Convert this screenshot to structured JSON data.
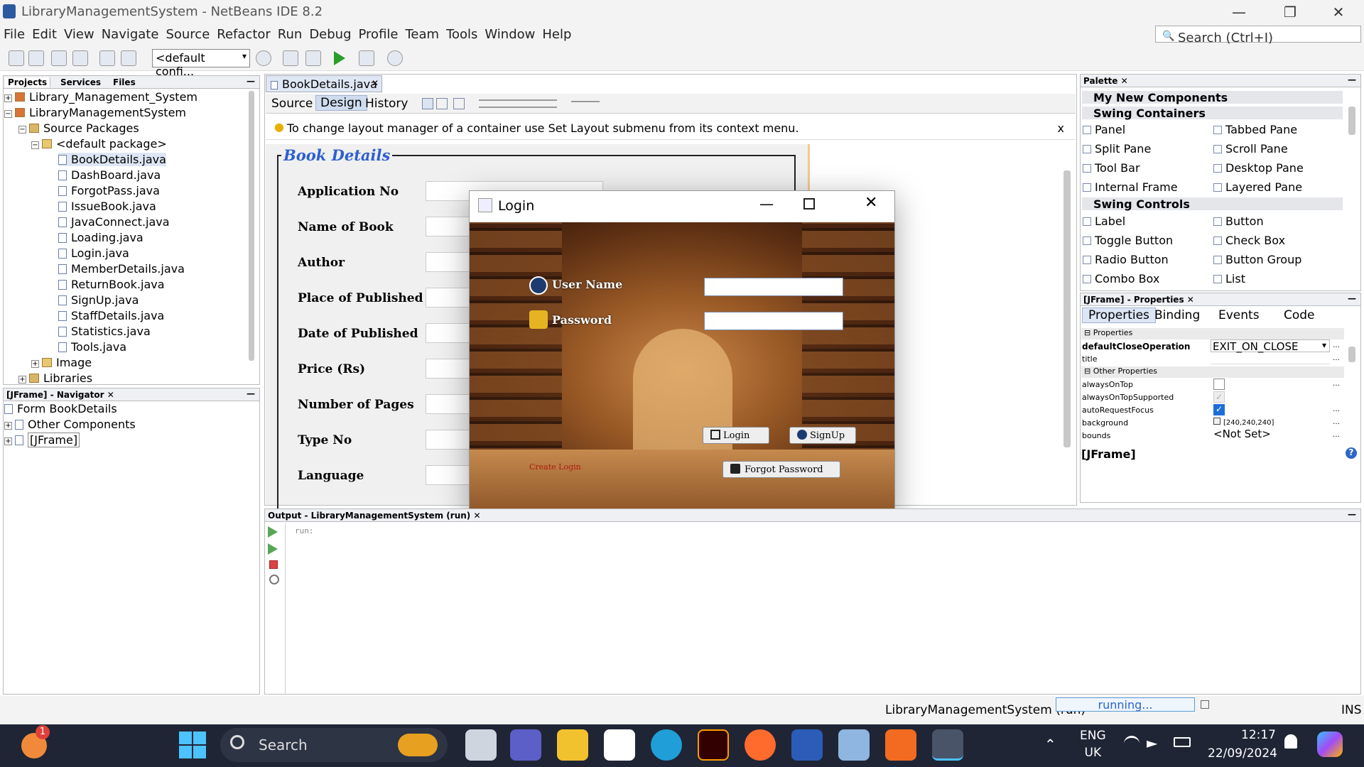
{
  "window": {
    "title": "LibraryManagementSystem - NetBeans IDE 8.2"
  },
  "menu": [
    "File",
    "Edit",
    "View",
    "Navigate",
    "Source",
    "Refactor",
    "Run",
    "Debug",
    "Profile",
    "Team",
    "Tools",
    "Window",
    "Help"
  ],
  "search": {
    "placeholder": "Search (Ctrl+I)"
  },
  "toolbar": {
    "config": "<default confi..."
  },
  "left_tabs": [
    "Projects",
    "Services",
    "Files"
  ],
  "tree": {
    "p1": "Library_Management_System",
    "p2": "LibraryManagementSystem",
    "src": "Source Packages",
    "pkg": "<default package>",
    "files": [
      "BookDetails.java",
      "DashBoard.java",
      "ForgotPass.java",
      "IssueBook.java",
      "JavaConnect.java",
      "Loading.java",
      "Login.java",
      "MemberDetails.java",
      "ReturnBook.java",
      "SignUp.java",
      "StaffDetails.java",
      "Statistics.java",
      "Tools.java"
    ],
    "image": "Image",
    "libraries": "Libraries"
  },
  "navigator": {
    "title": "[JFrame] - Navigator",
    "items": [
      "Form BookDetails",
      "Other Components",
      "[JFrame]"
    ]
  },
  "editor": {
    "tab": "BookDetails.java",
    "modes": [
      "Source",
      "Design",
      "History"
    ],
    "hint": "To change layout manager of a container use Set Layout submenu from its context menu.",
    "hint_close": "x",
    "form_title": "Book Details",
    "labels": [
      "Application No",
      "Name of Book",
      "Author",
      "Place of Published",
      "Date of Published",
      "Price (Rs)",
      "Number of Pages",
      "Type No",
      "Language"
    ]
  },
  "login": {
    "title": "Login",
    "username_label": "User Name",
    "password_label": "Password",
    "login_btn": "Login",
    "signup_btn": "SignUp",
    "forgot_btn": "Forgot Password",
    "faint_text": "Create Login"
  },
  "output": {
    "title": "Output - LibraryManagementSystem (run)",
    "text": "run:"
  },
  "palette": {
    "title": "Palette",
    "sections": [
      "My New Components",
      "Swing Containers",
      "Swing Controls"
    ],
    "containers": [
      [
        "Panel",
        "Tabbed Pane"
      ],
      [
        "Split Pane",
        "Scroll Pane"
      ],
      [
        "Tool Bar",
        "Desktop Pane"
      ],
      [
        "Internal Frame",
        "Layered Pane"
      ]
    ],
    "controls": [
      [
        "Label",
        "Button"
      ],
      [
        "Toggle Button",
        "Check Box"
      ],
      [
        "Radio Button",
        "Button Group"
      ],
      [
        "Combo Box",
        "List"
      ]
    ]
  },
  "properties": {
    "title": "[JFrame] - Properties",
    "tabs": [
      "Properties",
      "Binding",
      "Events",
      "Code"
    ],
    "group1": "Properties",
    "group2": "Other Properties",
    "rows": [
      {
        "name": "defaultCloseOperation",
        "value": "EXIT_ON_CLOSE"
      },
      {
        "name": "title",
        "value": ""
      },
      {
        "name": "alwaysOnTop",
        "value": ""
      },
      {
        "name": "alwaysOnTopSupported",
        "value": ""
      },
      {
        "name": "autoRequestFocus",
        "value": ""
      },
      {
        "name": "background",
        "value": "[240,240,240]"
      },
      {
        "name": "bounds",
        "value": "<Not Set>"
      }
    ],
    "footer": "[JFrame]"
  },
  "status": {
    "project": "LibraryManagementSystem (run)",
    "progress": "running...",
    "mode": "INS"
  },
  "taskbar": {
    "search": "Search",
    "lang1": "ENG",
    "lang2": "UK",
    "time": "12:17",
    "date": "22/09/2024",
    "badge": "1"
  },
  "colors": {
    "accent": "#3a6fd8",
    "form_title": "#2d5fcf"
  }
}
